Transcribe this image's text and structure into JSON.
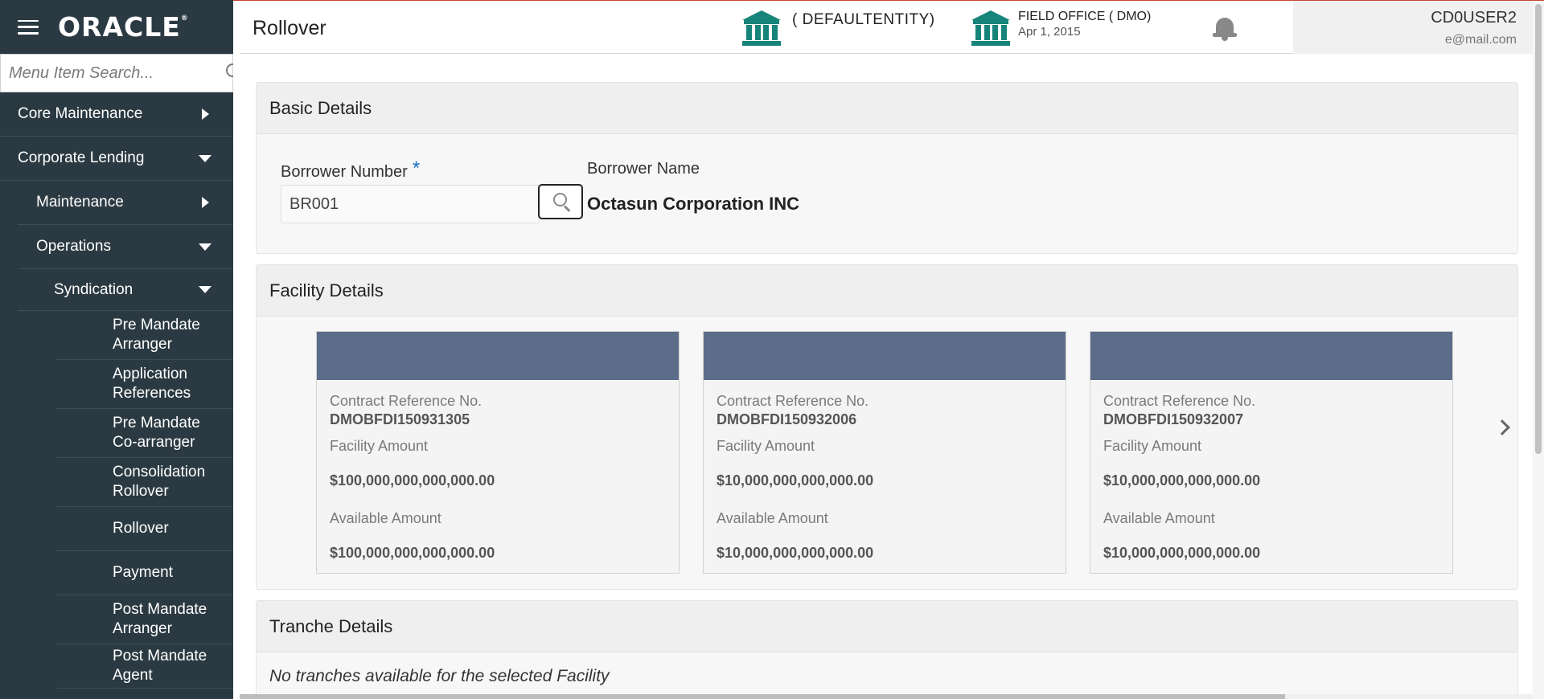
{
  "app": {
    "logo": "ORACLE",
    "logo_mark": "®"
  },
  "search": {
    "placeholder": "Menu Item Search..."
  },
  "sidebar": {
    "items": [
      {
        "label": "Core Maintenance"
      },
      {
        "label": "Corporate Lending"
      },
      {
        "label": "Maintenance"
      },
      {
        "label": "Operations"
      },
      {
        "label": "Syndication"
      },
      {
        "label": "Pre Mandate Arranger"
      },
      {
        "label": "Application References"
      },
      {
        "label": "Pre Mandate Co-arranger"
      },
      {
        "label": "Consolidation Rollover"
      },
      {
        "label": "Rollover"
      },
      {
        "label": "Payment"
      },
      {
        "label": "Post Mandate Arranger"
      },
      {
        "label": "Post Mandate Agent"
      }
    ]
  },
  "header": {
    "title": "Rollover",
    "entity": "( DEFAULTENTITY)",
    "office": "FIELD OFFICE  ( DMO)",
    "date": "Apr 1, 2015",
    "user": "CD0USER2",
    "email": "e@mail.com"
  },
  "basic": {
    "title": "Basic Details",
    "borrower_number_label": "Borrower Number",
    "required_mark": "*",
    "borrower_number_value": "BR001",
    "borrower_name_label": "Borrower Name",
    "borrower_name_value": "Octasun Corporation INC"
  },
  "facility": {
    "title": "Facility Details",
    "cards": [
      {
        "ref_label": "Contract Reference No.",
        "ref": "DMOBFDI150931305",
        "fac_label": "Facility Amount",
        "fac": "$100,000,000,000,000.00",
        "avail_label": "Available Amount",
        "avail": "$100,000,000,000,000.00"
      },
      {
        "ref_label": "Contract Reference No.",
        "ref": "DMOBFDI150932006",
        "fac_label": "Facility Amount",
        "fac": "$10,000,000,000,000.00",
        "avail_label": "Available Amount",
        "avail": "$10,000,000,000,000.00"
      },
      {
        "ref_label": "Contract Reference No.",
        "ref": "DMOBFDI150932007",
        "fac_label": "Facility Amount",
        "fac": "$10,000,000,000,000.00",
        "avail_label": "Available Amount",
        "avail": "$10,000,000,000,000.00"
      }
    ]
  },
  "tranche": {
    "title": "Tranche Details",
    "empty_message": "No tranches available for the selected Facility"
  },
  "colors": {
    "accent": "#17847a",
    "sidebar_bg": "#2b3a42",
    "card_header": "#5c6d8a"
  },
  "icons": {
    "menu": "hamburger-icon",
    "search": "search-icon",
    "bank": "bank-icon",
    "notification": "bell-icon",
    "next": "chevron-right-icon"
  }
}
